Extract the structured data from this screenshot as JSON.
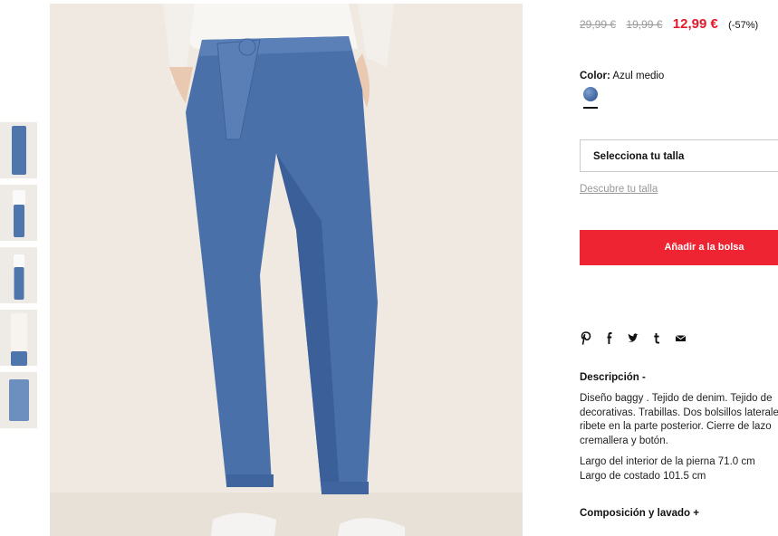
{
  "product": {
    "prices": {
      "original": "29,99 €",
      "previous": "19,99 €",
      "current": "12,99 €",
      "discount": "(-57%)"
    },
    "color_label": "Color:",
    "color_value": "Azul medio",
    "size_select": "Selecciona tu talla",
    "size_guide_link": "Descubre tu talla",
    "add_to_bag": "Añadir a la bolsa",
    "share_icons": [
      "pinterest-icon",
      "facebook-icon",
      "twitter-icon",
      "tumblr-icon",
      "mail-icon"
    ],
    "description_title": "Descripción -",
    "description_lines": [
      "Diseño baggy . Tejido de denim. Tejido de",
      "decorativas. Trabillas. Dos bolsillos laterale",
      "ribete en la parte posterior. Cierre de lazo",
      "cremallera y botón."
    ],
    "measures": [
      "Largo del interior de la pierna 71.0 cm",
      "Largo de costado 101.5 cm"
    ],
    "composition_title": "Composición y lavado +"
  },
  "colors": {
    "accent": "#ef2433",
    "price_red": "#e3192b",
    "denim": "#4a70aa"
  }
}
